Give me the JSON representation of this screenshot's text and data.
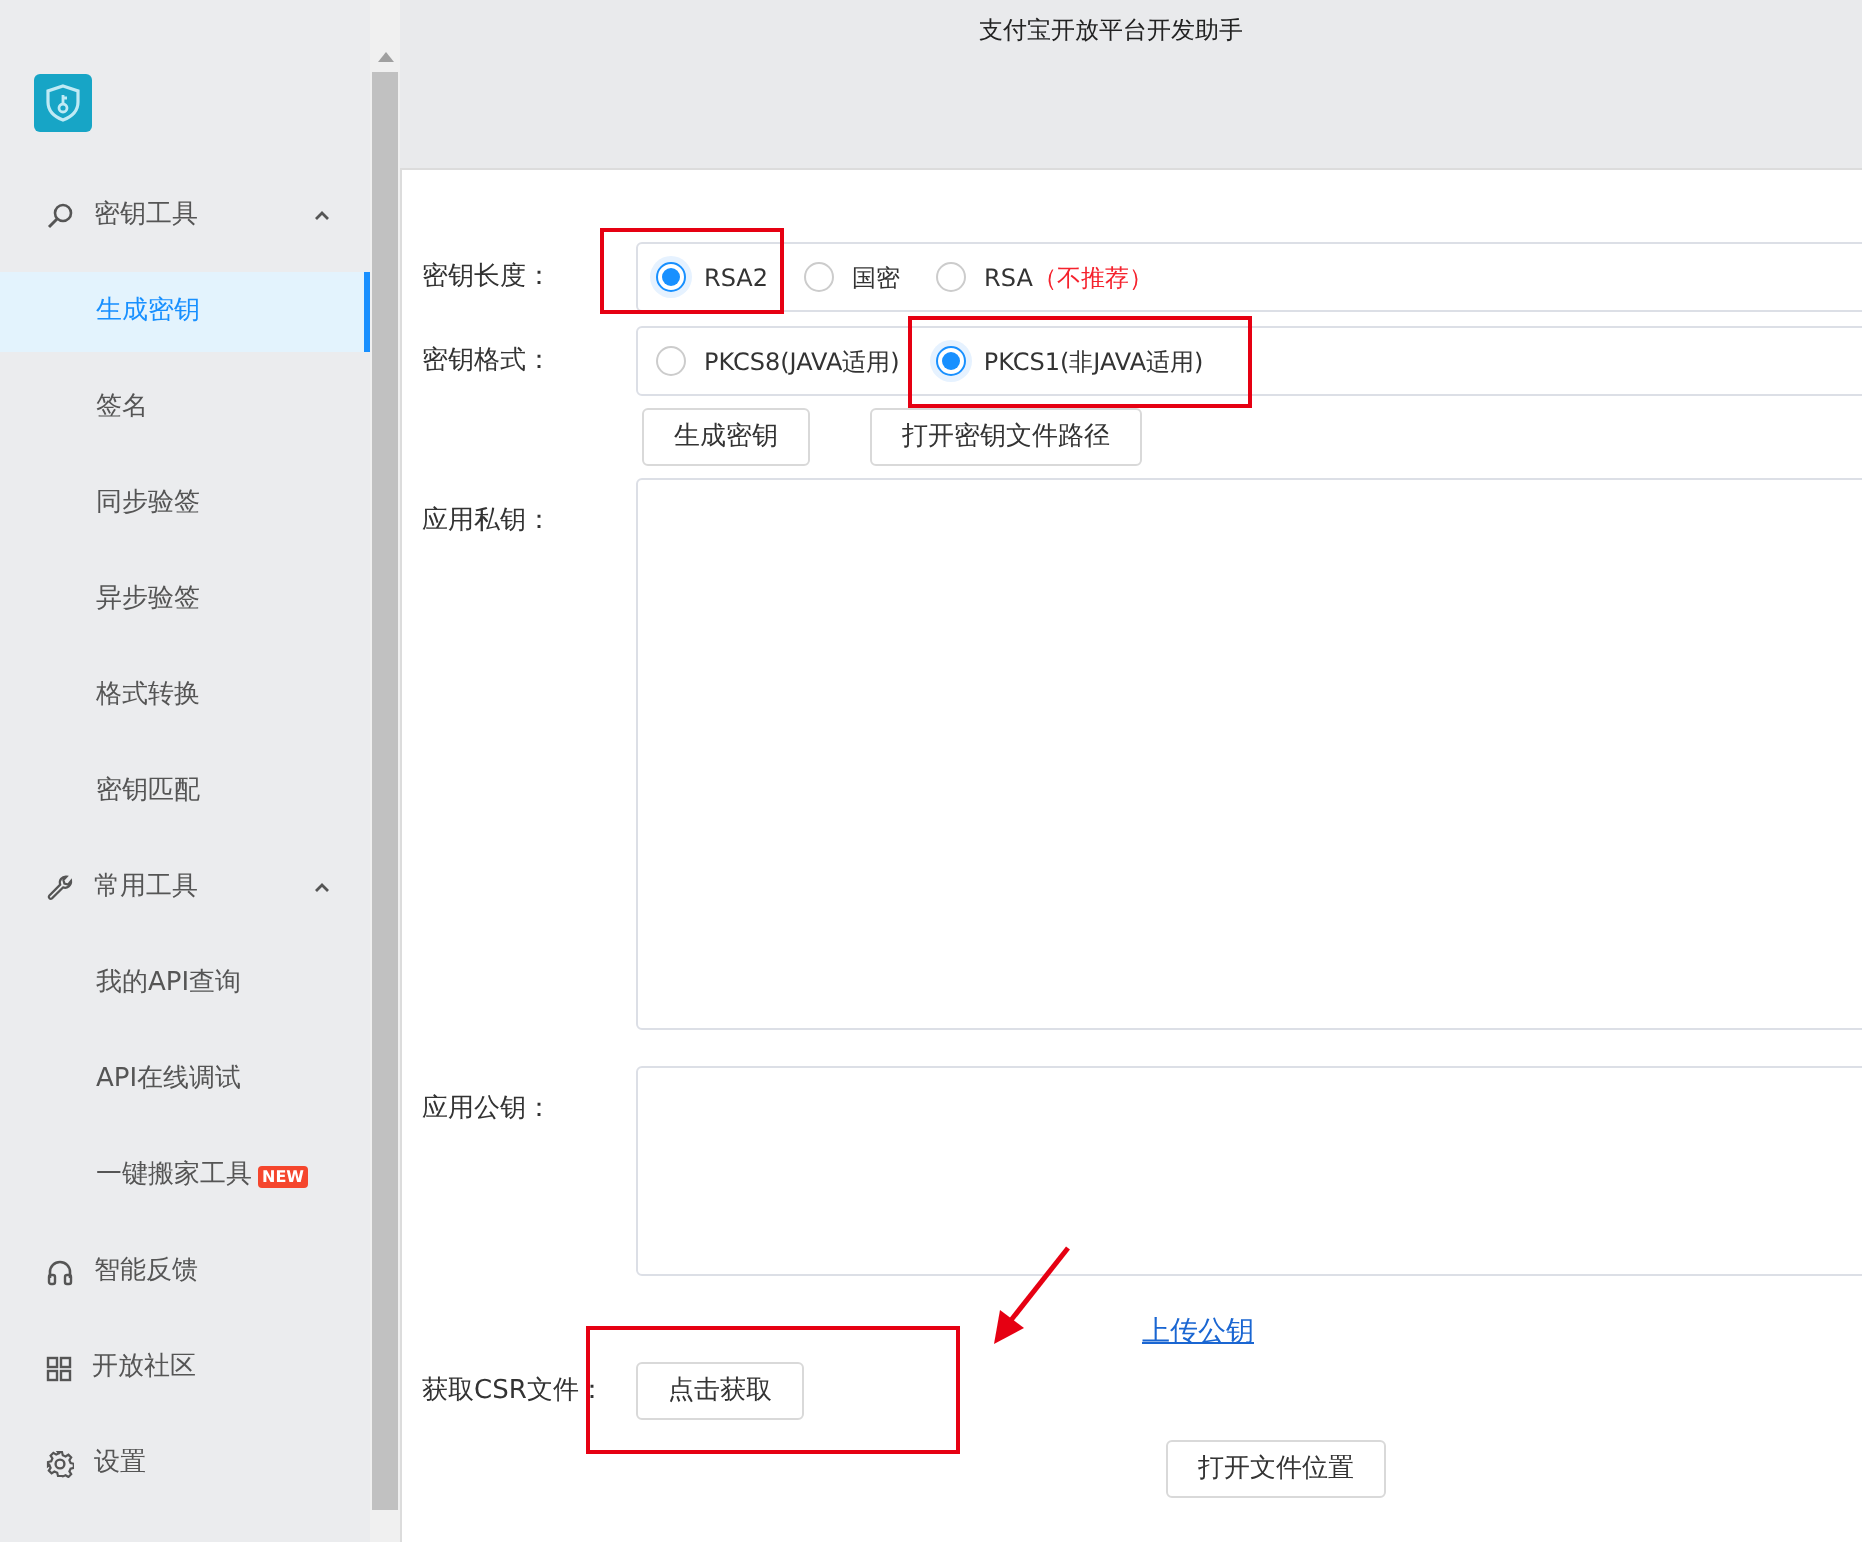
{
  "window": {
    "title": "支付宝开放平台开发助手"
  },
  "sidebar": {
    "items": [
      {
        "kind": "group",
        "label": "密钥工具",
        "expanded": true,
        "children": [
          {
            "label": "生成密钥",
            "selected": true
          },
          {
            "label": "签名",
            "selected": false
          },
          {
            "label": "同步验签",
            "selected": false
          },
          {
            "label": "异步验签",
            "selected": false
          },
          {
            "label": "格式转换",
            "selected": false
          },
          {
            "label": "密钥匹配",
            "selected": false
          }
        ]
      },
      {
        "kind": "group",
        "label": "常用工具",
        "expanded": true,
        "children": [
          {
            "label": "我的API查询",
            "selected": false
          },
          {
            "label": "API在线调试",
            "selected": false
          },
          {
            "label": "一键搬家工具",
            "badge": "NEW",
            "selected": false
          }
        ]
      },
      {
        "kind": "item",
        "label": "智能反馈",
        "selected": false
      },
      {
        "kind": "item",
        "label": "开放社区",
        "selected": false
      },
      {
        "kind": "item",
        "label": "设置",
        "selected": false
      }
    ]
  },
  "form": {
    "key_length": {
      "label": "密钥长度：",
      "options": [
        {
          "label": "RSA2",
          "selected": true
        },
        {
          "label": "国密",
          "selected": false
        },
        {
          "label": "RSA",
          "note": "（不推荐）",
          "selected": false
        }
      ]
    },
    "key_format": {
      "label": "密钥格式：",
      "options": [
        {
          "label": "PKCS8(JAVA适用)",
          "selected": false
        },
        {
          "label": "PKCS1(非JAVA适用)",
          "selected": true
        }
      ]
    },
    "buttons": [
      "生成密钥",
      "打开密钥文件路径"
    ],
    "private_key": {
      "label": "应用私钥："
    },
    "public_key": {
      "label": "应用公钥："
    },
    "upload_link": "上传公钥",
    "csr": {
      "label": "获取CSR文件：",
      "button": "点击获取"
    },
    "open_location_button": "打开文件位置"
  },
  "annotations": [
    {
      "kind": "box"
    },
    {
      "kind": "box"
    },
    {
      "kind": "box"
    },
    {
      "kind": "arrow"
    }
  ]
}
